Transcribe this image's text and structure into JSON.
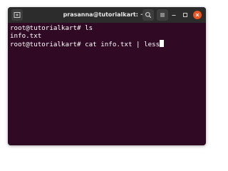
{
  "window": {
    "title": "prasanna@tutorialkart: ~"
  },
  "titlebar": {
    "new_tab_icon": "new-tab-icon",
    "search_icon": "search-icon",
    "menu_icon": "hamburger-menu-icon",
    "minimize_icon": "minimize-icon",
    "maximize_icon": "maximize-icon",
    "close_icon": "close-icon"
  },
  "terminal": {
    "lines": [
      "root@tutorialkart# ls",
      "info.txt",
      "root@tutorialkart# cat info.txt | less"
    ]
  },
  "colors": {
    "terminal_bg": "#300a24",
    "titlebar_bg": "#2c2c2c",
    "close_button": "#e95420",
    "text": "#ffffff"
  }
}
